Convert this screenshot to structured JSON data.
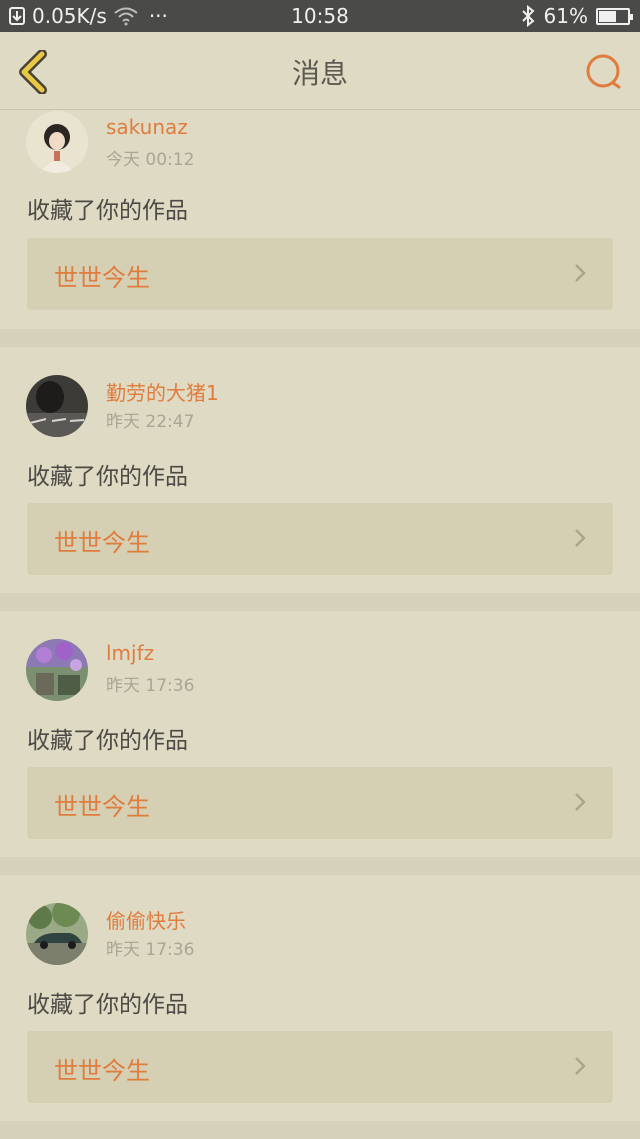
{
  "status_bar": {
    "network_speed": "0.05K/s",
    "dots": "···",
    "time": "10:58",
    "battery_percent": "61%",
    "battery_level": 0.61
  },
  "header": {
    "title": "消息"
  },
  "colors": {
    "accent": "#e07c3e",
    "background": "#dedac3",
    "card": "#d5d0b3"
  },
  "messages": [
    {
      "user": "sakunaz",
      "time": "今天 00:12",
      "action": "收藏了你的作品",
      "work": "世世今生",
      "avatar": "avatar-boy-illustration"
    },
    {
      "user": "勤劳的大猪1",
      "time": "昨天 22:47",
      "action": "收藏了你的作品",
      "work": "世世今生",
      "avatar": "avatar-dark-photo"
    },
    {
      "user": "lmjfz",
      "time": "昨天 17:36",
      "action": "收藏了你的作品",
      "work": "世世今生",
      "avatar": "avatar-flowers"
    },
    {
      "user": "偷偷快乐",
      "time": "昨天 17:36",
      "action": "收藏了你的作品",
      "work": "世世今生",
      "avatar": "avatar-vintage-car"
    }
  ]
}
